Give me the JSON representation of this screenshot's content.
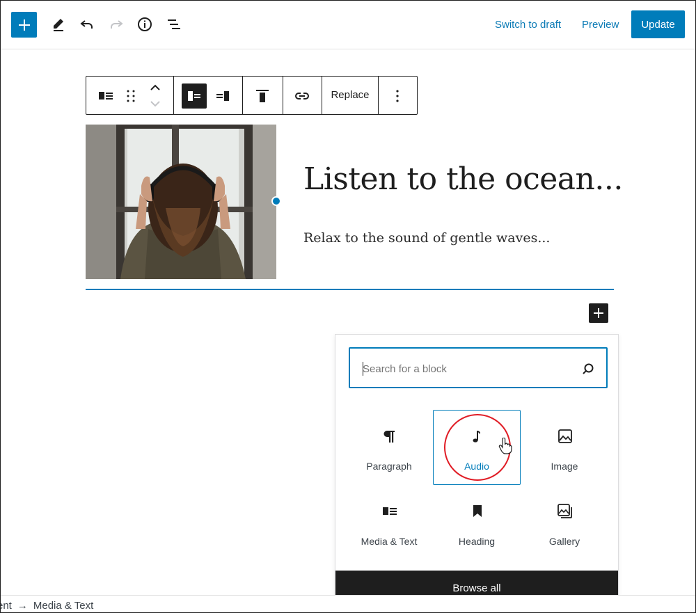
{
  "topbar": {
    "switch_to_draft": "Switch to draft",
    "preview": "Preview",
    "update": "Update"
  },
  "block_toolbar": {
    "replace_label": "Replace"
  },
  "media_text": {
    "heading": "Listen to the ocean...",
    "paragraph": "Relax to the sound of gentle waves..."
  },
  "inserter": {
    "search_placeholder": "Search for a block",
    "blocks": [
      {
        "label": "Paragraph",
        "icon": "paragraph-icon"
      },
      {
        "label": "Audio",
        "icon": "audio-icon"
      },
      {
        "label": "Image",
        "icon": "image-icon"
      },
      {
        "label": "Media & Text",
        "icon": "media-text-icon"
      },
      {
        "label": "Heading",
        "icon": "heading-icon"
      },
      {
        "label": "Gallery",
        "icon": "gallery-icon"
      }
    ],
    "browse_all": "Browse all"
  },
  "breadcrumb": {
    "parent": "ent",
    "separator": "→",
    "current": "Media & Text"
  },
  "colors": {
    "accent": "#007cba",
    "dark": "#1e1e1e",
    "highlight_circle": "#e01b24"
  }
}
